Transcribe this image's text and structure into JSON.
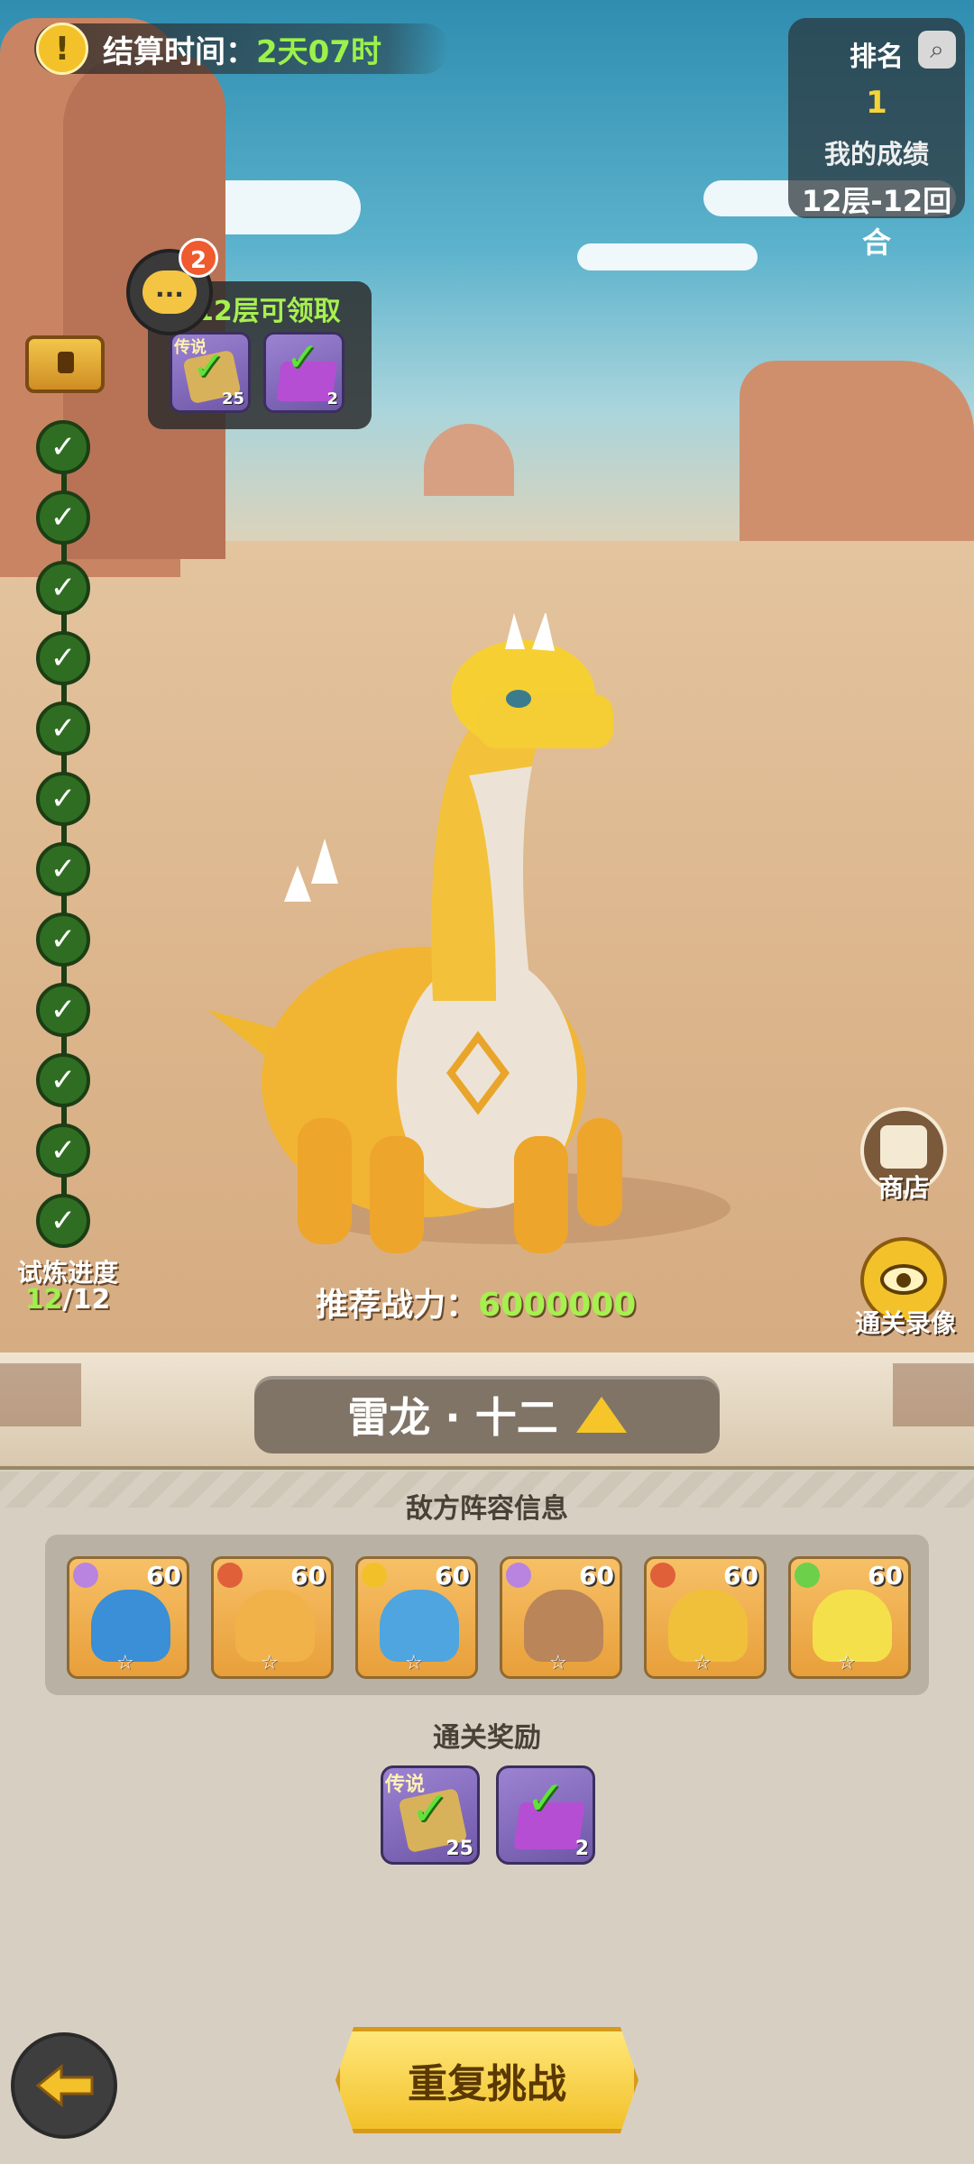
{
  "settlement": {
    "label": "结算时间：",
    "value": "2天07时"
  },
  "rank_panel": {
    "title": "排名",
    "rank": "1",
    "score_label": "我的成绩",
    "score": "12层-12回合"
  },
  "chat": {
    "badge_count": "2",
    "bubble": "..."
  },
  "floor_reward_popup": {
    "title": "12层可领取",
    "items": [
      {
        "tag": "传说",
        "count": "25",
        "icon": "puzzle-check-icon"
      },
      {
        "tag": "",
        "count": "2",
        "icon": "purple-box-icon"
      }
    ]
  },
  "progress": {
    "completed_nodes": 12,
    "label": "试炼进度",
    "current": "12",
    "total": "/12",
    "node_icon": "✓"
  },
  "shop": {
    "label": "商店",
    "icon": "shop-icon"
  },
  "replay": {
    "label": "通关录像",
    "icon": "eye-icon"
  },
  "power": {
    "label": "推荐战力：",
    "value": "6000000"
  },
  "level": {
    "name": "雷龙 · 十二"
  },
  "enemy_section": {
    "title": "敌方阵容信息",
    "units": [
      {
        "level": "60",
        "element_color": "#b884e0",
        "body_color": "#3a8fd6",
        "star": "☆"
      },
      {
        "level": "60",
        "element_color": "#e0603a",
        "body_color": "#f1b24a",
        "star": "☆"
      },
      {
        "level": "60",
        "element_color": "#f2c12a",
        "body_color": "#4fa5e0",
        "star": "☆"
      },
      {
        "level": "60",
        "element_color": "#b884e0",
        "body_color": "#b98559",
        "star": "☆"
      },
      {
        "level": "60",
        "element_color": "#e0603a",
        "body_color": "#f0c03a",
        "star": "☆"
      },
      {
        "level": "60",
        "element_color": "#6cd04a",
        "body_color": "#f4e04a",
        "star": "☆"
      }
    ]
  },
  "clear_rewards": {
    "title": "通关奖励",
    "items": [
      {
        "tag": "传说",
        "count": "25",
        "icon": "puzzle-check-icon"
      },
      {
        "tag": "",
        "count": "2",
        "icon": "purple-box-icon"
      }
    ]
  },
  "buttons": {
    "retry": "重复挑战",
    "back_icon": "back-arrow-icon"
  },
  "colors": {
    "accent_green": "#9cf14a",
    "gold": "#f3c22a",
    "panel": "#d7d0c2"
  }
}
